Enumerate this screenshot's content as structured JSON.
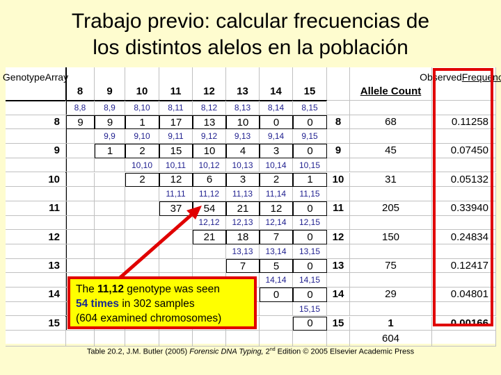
{
  "title_line1": "Trabajo previo: calcular frecuencias de",
  "title_line2": "los distintos alelos en la población",
  "table": {
    "corner_line1": "Genotype",
    "corner_line2": "Array",
    "column_headers": [
      "8",
      "9",
      "10",
      "11",
      "12",
      "13",
      "14",
      "15"
    ],
    "allele_count_header": "Allele Count",
    "freq_header_line1": "Observed",
    "freq_header_line2": "Frequency",
    "rows": [
      {
        "allele": "8",
        "genotypes": [
          "8,8",
          "8,9",
          "8,10",
          "8,11",
          "8,12",
          "8,13",
          "8,14",
          "8,15"
        ],
        "counts": [
          "9",
          "9",
          "1",
          "17",
          "13",
          "10",
          "0",
          "0"
        ],
        "allele_count": "68",
        "frequency": "0.11258"
      },
      {
        "allele": "9",
        "genotypes": [
          "",
          "9,9",
          "9,10",
          "9,11",
          "9,12",
          "9,13",
          "9,14",
          "9,15"
        ],
        "counts": [
          "",
          "1",
          "2",
          "15",
          "10",
          "4",
          "3",
          "0"
        ],
        "allele_count": "45",
        "frequency": "0.07450"
      },
      {
        "allele": "10",
        "genotypes": [
          "",
          "",
          "10,10",
          "10,11",
          "10,12",
          "10,13",
          "10,14",
          "10,15"
        ],
        "counts": [
          "",
          "",
          "2",
          "12",
          "6",
          "3",
          "2",
          "1"
        ],
        "allele_count": "31",
        "frequency": "0.05132"
      },
      {
        "allele": "11",
        "genotypes": [
          "",
          "",
          "",
          "11,11",
          "11,12",
          "11,13",
          "11,14",
          "11,15"
        ],
        "counts": [
          "",
          "",
          "",
          "37",
          "54",
          "21",
          "12",
          "0"
        ],
        "allele_count": "205",
        "frequency": "0.33940"
      },
      {
        "allele": "12",
        "genotypes": [
          "",
          "",
          "",
          "",
          "12,12",
          "12,13",
          "12,14",
          "12,15"
        ],
        "counts": [
          "",
          "",
          "",
          "",
          "21",
          "18",
          "7",
          "0"
        ],
        "allele_count": "150",
        "frequency": "0.24834"
      },
      {
        "allele": "13",
        "genotypes": [
          "",
          "",
          "",
          "",
          "",
          "13,13",
          "13,14",
          "13,15"
        ],
        "counts": [
          "",
          "",
          "",
          "",
          "",
          "7",
          "5",
          "0"
        ],
        "allele_count": "75",
        "frequency": "0.12417"
      },
      {
        "allele": "14",
        "genotypes": [
          "",
          "",
          "",
          "",
          "",
          "",
          "14,14",
          "14,15"
        ],
        "counts": [
          "",
          "",
          "",
          "",
          "",
          "",
          "0",
          "0"
        ],
        "allele_count": "29",
        "frequency": "0.04801"
      },
      {
        "allele": "15",
        "genotypes": [
          "",
          "",
          "",
          "",
          "",
          "",
          "",
          "15,15"
        ],
        "counts": [
          "",
          "",
          "",
          "",
          "",
          "",
          "",
          "0"
        ],
        "allele_count": "1",
        "frequency": "0.00166"
      }
    ],
    "total_allele_count": "604"
  },
  "callout": {
    "part1": "The ",
    "highlight1": "11,12",
    "part2": " genotype was seen",
    "highlight2": "54 times",
    "part3": " in 302 samples",
    "line3": "(604 examined chromosomes)"
  },
  "caption": {
    "part1": "Table 20.2, J.M. Butler (2005) ",
    "italic": "Forensic DNA Typing,",
    "part2": " 2",
    "sup": "nd",
    "part3": " Edition © 2005 Elsevier Academic Press"
  },
  "colors": {
    "background": "#fefccf",
    "highlight_red": "#e00000",
    "callout_yellow": "#ffff00",
    "genotype_blue": "#1f1f8f"
  }
}
